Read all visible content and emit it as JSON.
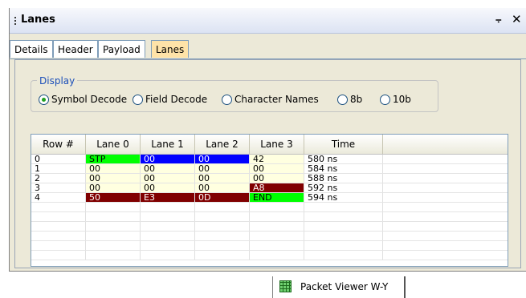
{
  "window": {
    "title": "Lanes",
    "pin_glyph": "⨪",
    "close_glyph": "✕"
  },
  "tabs": [
    {
      "label": "Details",
      "active": false
    },
    {
      "label": "Header",
      "active": false
    },
    {
      "label": "Payload",
      "active": false
    },
    {
      "label": "Lanes",
      "active": true
    }
  ],
  "display": {
    "legend": "Display",
    "options": [
      {
        "label": "Symbol Decode",
        "checked": true
      },
      {
        "label": "Field Decode",
        "checked": false
      },
      {
        "label": "Character Names",
        "checked": false
      },
      {
        "label": "8b",
        "checked": false
      },
      {
        "label": "10b",
        "checked": false
      }
    ]
  },
  "grid": {
    "columns": [
      "Row #",
      "Lane 0",
      "Lane 1",
      "Lane 2",
      "Lane 3",
      "Time"
    ],
    "rows": [
      {
        "cells": [
          "0",
          "STP",
          "00",
          "00",
          "42",
          "580 ns"
        ]
      },
      {
        "cells": [
          "1",
          "00",
          "00",
          "00",
          "00",
          "584 ns"
        ]
      },
      {
        "cells": [
          "2",
          "00",
          "00",
          "00",
          "00",
          "588 ns"
        ]
      },
      {
        "cells": [
          "3",
          "00",
          "00",
          "00",
          "A8",
          "592 ns"
        ]
      },
      {
        "cells": [
          "4",
          "50",
          "E3",
          "0D",
          "END",
          "594 ns"
        ]
      }
    ],
    "cell_colors": {
      "0": [
        "",
        "green",
        "blue",
        "blue",
        "cream",
        ""
      ],
      "1": [
        "",
        "cream",
        "cream",
        "cream",
        "cream",
        ""
      ],
      "2": [
        "",
        "cream",
        "cream",
        "cream",
        "cream",
        ""
      ],
      "3": [
        "",
        "cream",
        "cream",
        "cream",
        "maroon",
        ""
      ],
      "4": [
        "",
        "maroon",
        "maroon",
        "maroon",
        "green",
        ""
      ]
    },
    "colors": {
      "green": "#00ff00",
      "blue": "#0000ff",
      "maroon": "#800000",
      "cream": "#ffffe0"
    }
  },
  "bottom_tab": {
    "label": "Packet Viewer W-Y",
    "icon": "grid-table-icon"
  }
}
